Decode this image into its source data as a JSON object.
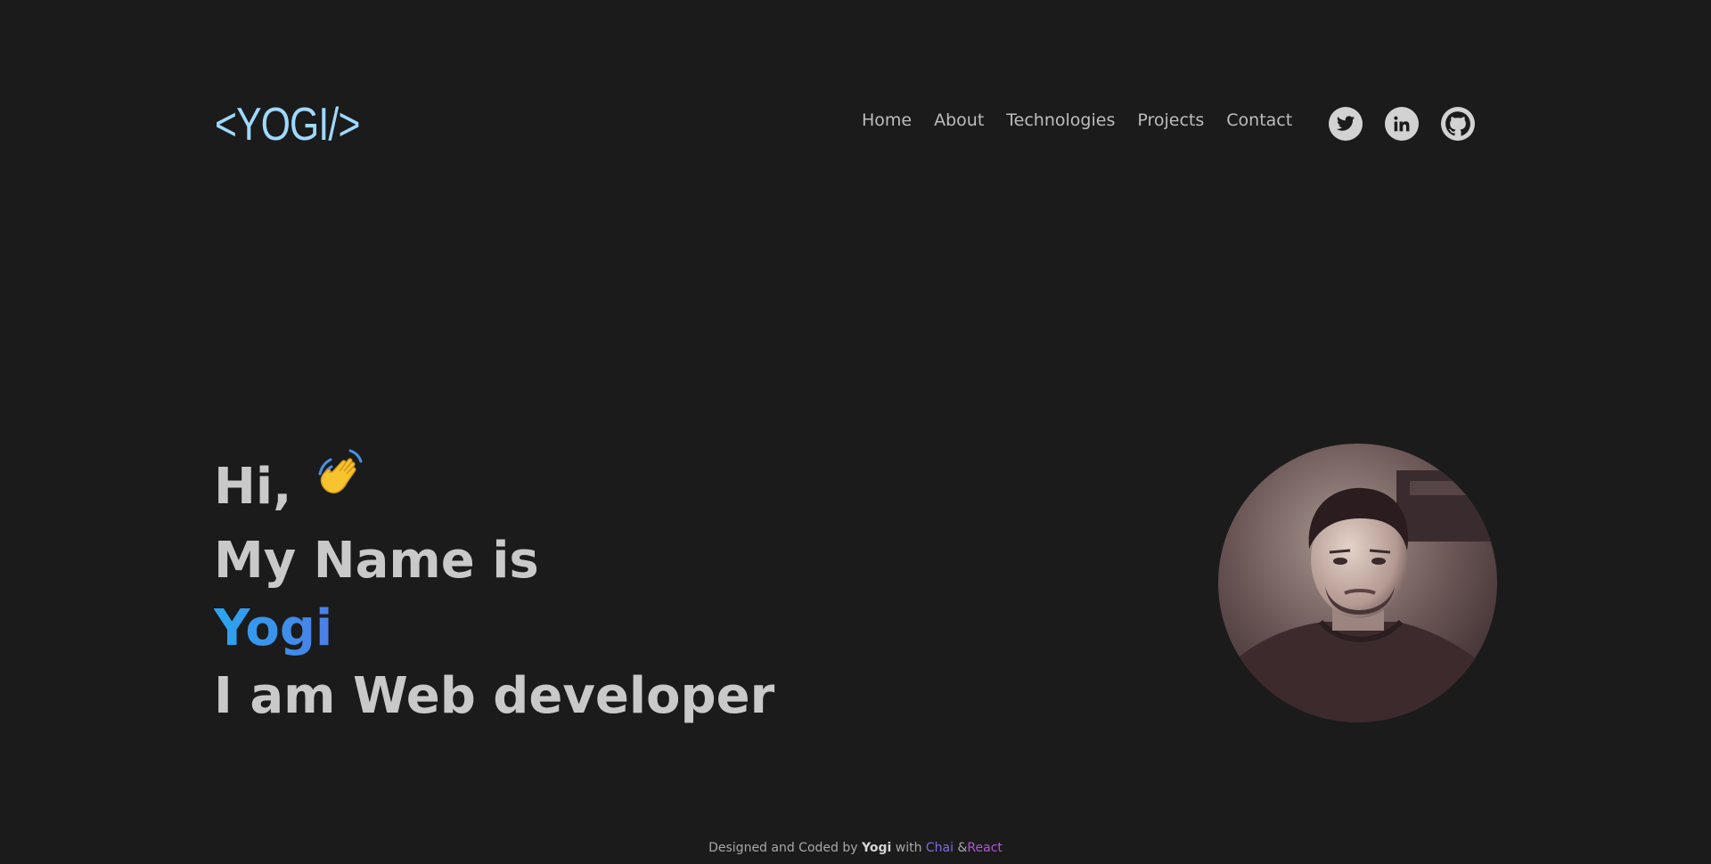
{
  "header": {
    "logo_text": "<YOGI/>",
    "nav": [
      {
        "label": "Home"
      },
      {
        "label": "About"
      },
      {
        "label": "Technologies"
      },
      {
        "label": "Projects"
      },
      {
        "label": "Contact"
      }
    ],
    "socials": [
      {
        "icon": "twitter-icon"
      },
      {
        "icon": "linkedin-icon"
      },
      {
        "icon": "github-icon"
      }
    ]
  },
  "hero": {
    "greeting": "Hi,",
    "wave_icon": "waving-hand-icon",
    "intro": "My Name is",
    "name": "Yogi",
    "role": "I am Web developer",
    "name_gradient": [
      "#2aa6f0",
      "#4d7ee6"
    ]
  },
  "profile": {
    "image": "profile-photo"
  },
  "footer": {
    "prefix": "Designed and Coded by",
    "author": "Yogi",
    "with": "with",
    "tech1": "Chai",
    "amp": "&",
    "tech2": "React"
  },
  "colors": {
    "background": "#1b1b1b",
    "logo": "#9fd9ff",
    "text": "#c9c9c9",
    "nav": "#bdbdbd",
    "social_bg": "#d2d2d2"
  }
}
